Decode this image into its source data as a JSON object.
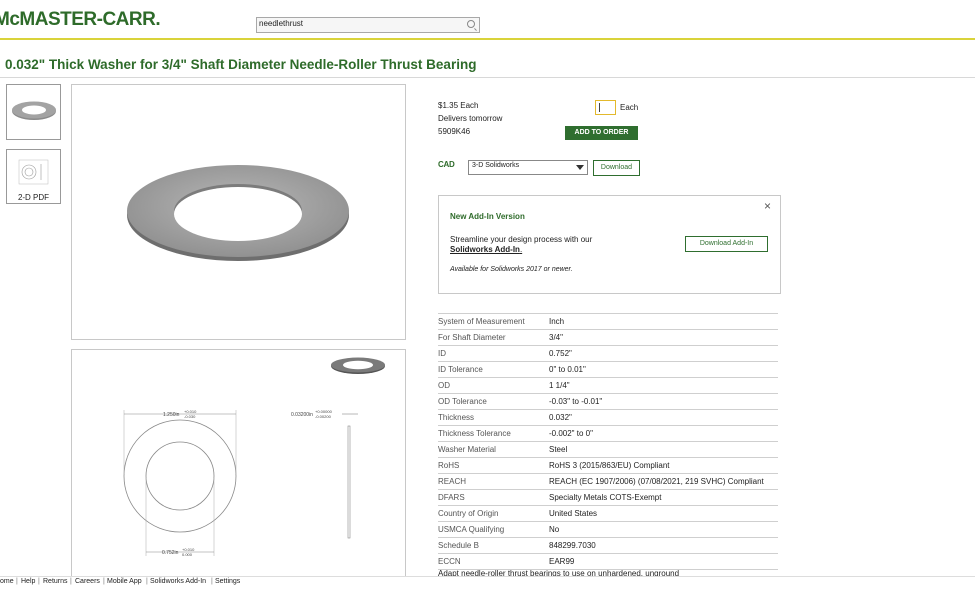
{
  "header": {
    "logo": "McMASTER-CARR.",
    "search_value": "needlethrust"
  },
  "title": "0.032\" Thick Washer for 3/4\" Shaft Diameter Needle-Roller Thrust Bearing",
  "thumbnails": [
    {
      "label": ""
    },
    {
      "label": "2-D PDF"
    }
  ],
  "order": {
    "price": "$1.35 Each",
    "delivers": "Delivers tomorrow",
    "part_number": "5909K46",
    "qty_value": "",
    "qty_unit": "Each",
    "add_button": "ADD TO ORDER"
  },
  "cad": {
    "icon_label": "CAD",
    "selected_format": "3-D Solidworks",
    "download_button": "Download"
  },
  "addin": {
    "title": "New Add-In Version",
    "text1": "Streamline your design process with our",
    "link": "Solidworks Add-In",
    "link_suffix": ".",
    "note": "Available for Solidworks 2017 or newer.",
    "button": "Download Add-In",
    "close": "×"
  },
  "drawing": {
    "dim_od": "1.250in",
    "dim_od_tol_top": "+0.010",
    "dim_od_tol_bot": "-0.030",
    "dim_id": "0.752in",
    "dim_id_tol_top": "+0.010",
    "dim_id_tol_bot": "0.000",
    "dim_thick": "0.03200in",
    "dim_thick_tol_top": "+0.00000",
    "dim_thick_tol_bot": "-0.00200"
  },
  "specs": [
    {
      "label": "System of Measurement",
      "value": "Inch"
    },
    {
      "label": "For Shaft Diameter",
      "value": "3/4\""
    },
    {
      "label": "ID",
      "value": "0.752\""
    },
    {
      "label": "ID Tolerance",
      "value": "0\" to 0.01\""
    },
    {
      "label": "OD",
      "value": "1 1/4\""
    },
    {
      "label": "OD Tolerance",
      "value": "-0.03\" to -0.01\""
    },
    {
      "label": "Thickness",
      "value": "0.032\""
    },
    {
      "label": "Thickness Tolerance",
      "value": "-0.002\" to 0\""
    },
    {
      "label": "Washer Material",
      "value": "Steel"
    },
    {
      "label": "RoHS",
      "value": "RoHS 3 (2015/863/EU) Compliant"
    },
    {
      "label": "REACH",
      "value": "REACH (EC 1907/2006) (07/08/2021, 219 SVHC) Compliant"
    },
    {
      "label": "DFARS",
      "value": "Specialty Metals COTS-Exempt"
    },
    {
      "label": "Country of Origin",
      "value": "United States"
    },
    {
      "label": "USMCA Qualifying",
      "value": "No"
    },
    {
      "label": "Schedule B",
      "value": "848299.7030"
    },
    {
      "label": "ECCN",
      "value": "EAR99"
    }
  ],
  "description": "Adapt needle-roller thrust bearings to use on unhardened, unground",
  "footer": [
    "ome",
    "Help",
    "Returns",
    "Careers",
    "Mobile App",
    "Solidworks Add-In",
    "Settings"
  ]
}
